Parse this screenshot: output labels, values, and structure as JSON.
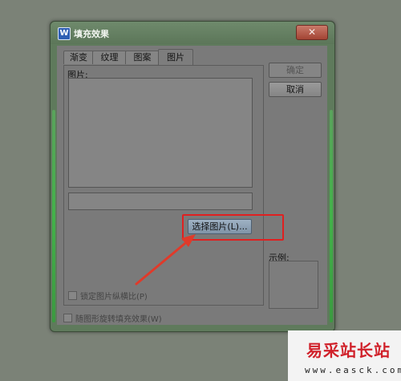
{
  "dialog": {
    "title": "填充效果",
    "app_logo": "W",
    "close_glyph": "✕"
  },
  "tabs": [
    {
      "label": "渐变",
      "active": false
    },
    {
      "label": "纹理",
      "active": false
    },
    {
      "label": "图案",
      "active": false
    },
    {
      "label": "图片",
      "active": true
    }
  ],
  "picture_panel": {
    "label": "图片:",
    "path_value": "",
    "select_button": "选择图片(L)...",
    "lock_aspect": {
      "label": "锁定图片纵横比(P)",
      "checked": false
    }
  },
  "buttons": {
    "ok": "确定",
    "cancel": "取消"
  },
  "sample_label": "示例:",
  "rotate_option": {
    "label": "随图形旋转填充效果(W)",
    "checked": false
  },
  "watermark": {
    "text": "易采站长站",
    "url": "www.easck.com"
  },
  "colors": {
    "highlight": "#e02020",
    "arrow": "#e03a2a",
    "watermark": "#d0212a"
  },
  "icons": [
    "word-app-icon",
    "close-icon",
    "checkbox-icon",
    "arrow-annotation"
  ]
}
